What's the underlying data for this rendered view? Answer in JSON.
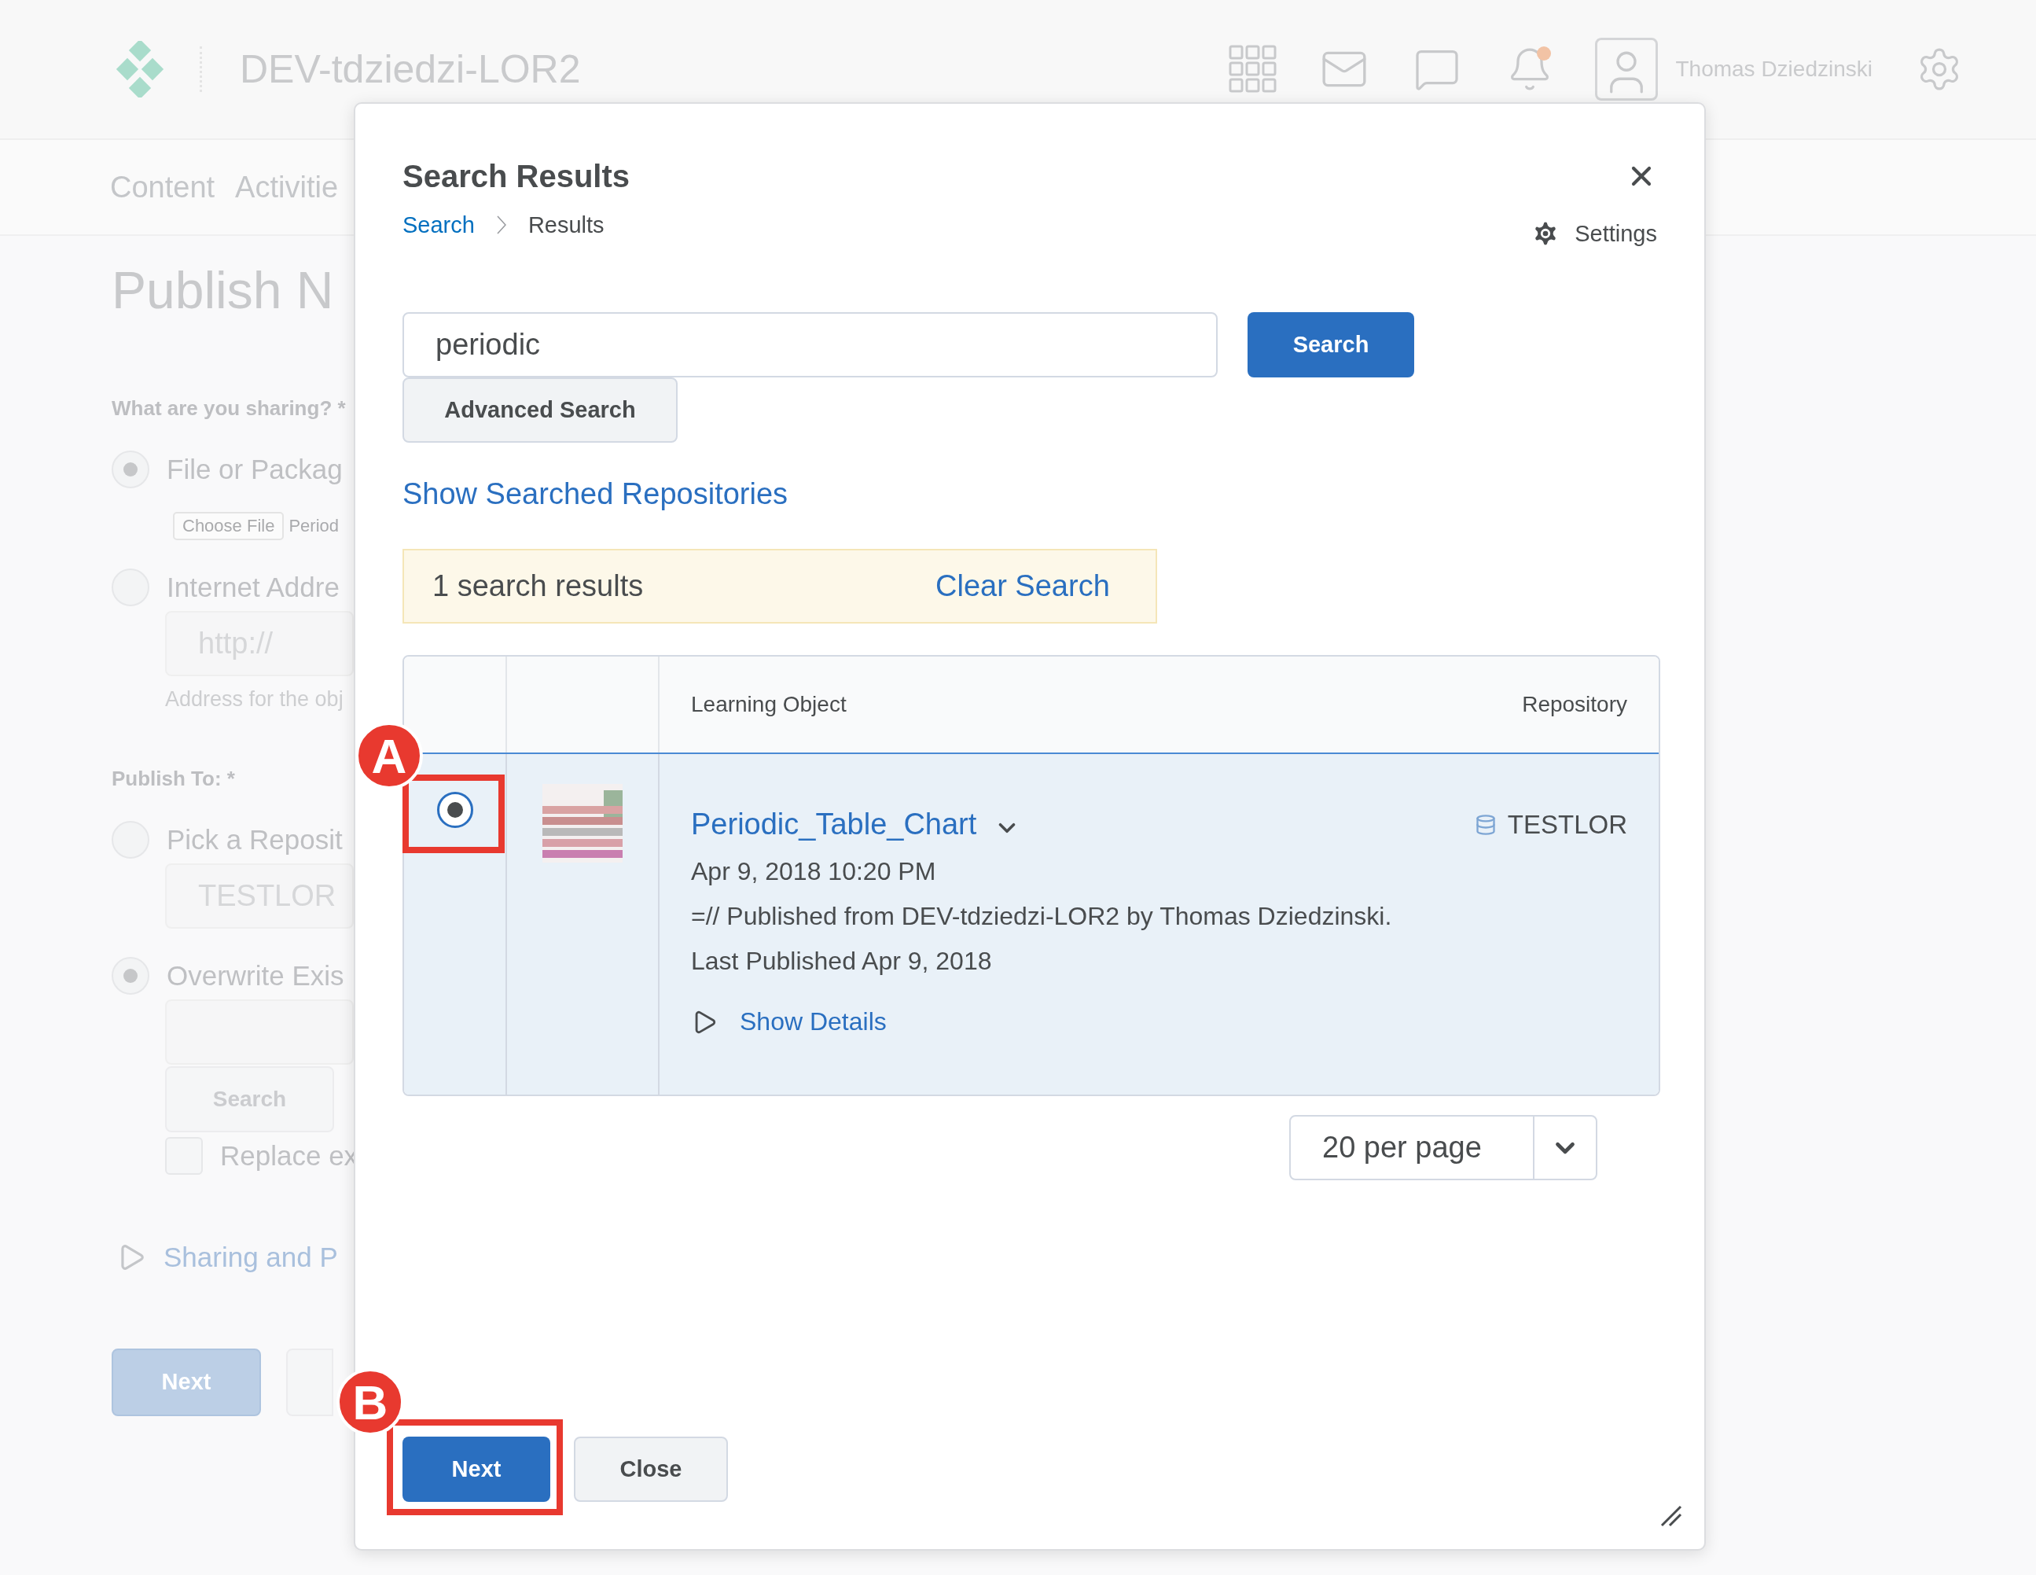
{
  "header": {
    "title": "DEV-tdziedzi-LOR2",
    "user_name": "Thomas Dziedzinski",
    "has_unread": true
  },
  "nav": [
    {
      "label": "Content"
    },
    {
      "label": "Activitie"
    }
  ],
  "page": {
    "title": "Publish N",
    "form": [
      {
        "kind": "label",
        "text": "What are you sharing?",
        "required": "*"
      },
      {
        "kind": "radio",
        "label": "File or Packag",
        "selected": true
      },
      {
        "kind": "file",
        "button": "Choose File",
        "file_name": "Period"
      },
      {
        "kind": "radio",
        "label": "Internet Addre",
        "selected": false
      },
      {
        "kind": "field",
        "placeholder": "http://"
      },
      {
        "kind": "hint",
        "text": "Address for the obj"
      },
      {
        "kind": "label",
        "text": "Publish To:",
        "required": "*"
      },
      {
        "kind": "radio",
        "label": "Pick a Reposit",
        "selected": false
      },
      {
        "kind": "field",
        "value": "TESTLOR"
      },
      {
        "kind": "radio",
        "label": "Overwrite Exis",
        "selected": true
      },
      {
        "kind": "field"
      },
      {
        "kind": "button",
        "label": "Search"
      },
      {
        "kind": "checkbox",
        "label": "Replace ex",
        "checked": false
      },
      {
        "kind": "expander",
        "label": "Sharing and P"
      }
    ],
    "buttons": [
      {
        "kind": "primary",
        "label": "Next"
      },
      {
        "kind": "secondary"
      }
    ]
  },
  "dialog": {
    "title": "Search Results",
    "breadcrumb": [
      {
        "label": "Search",
        "link": true
      },
      {
        "label": "Results",
        "link": false
      }
    ],
    "settings": "Settings",
    "search": {
      "value": "periodic",
      "button": "Search",
      "advanced": "Advanced Search"
    },
    "show_repositories": "Show Searched Repositories",
    "results_banner": {
      "count": "1 search results",
      "clear": "Clear Search"
    },
    "table": {
      "columns": [
        "Learning Object",
        "Repository"
      ],
      "rows": [
        {
          "selected": true,
          "title": "Periodic_Table_Chart",
          "date": "Apr 9, 2018 10:20 PM",
          "description": "=// Published from DEV-tdziedzi-LOR2 by Thomas Dziedzinski.",
          "last_published": "Last Published Apr 9, 2018",
          "details": "Show Details",
          "repository": "TESTLOR"
        }
      ]
    },
    "per_page": "20 per page",
    "buttons": [
      {
        "kind": "primary",
        "label": "Next"
      },
      {
        "kind": "secondary",
        "label": "Close"
      }
    ]
  },
  "annotations": [
    {
      "label": "A"
    },
    {
      "label": "B"
    }
  ]
}
